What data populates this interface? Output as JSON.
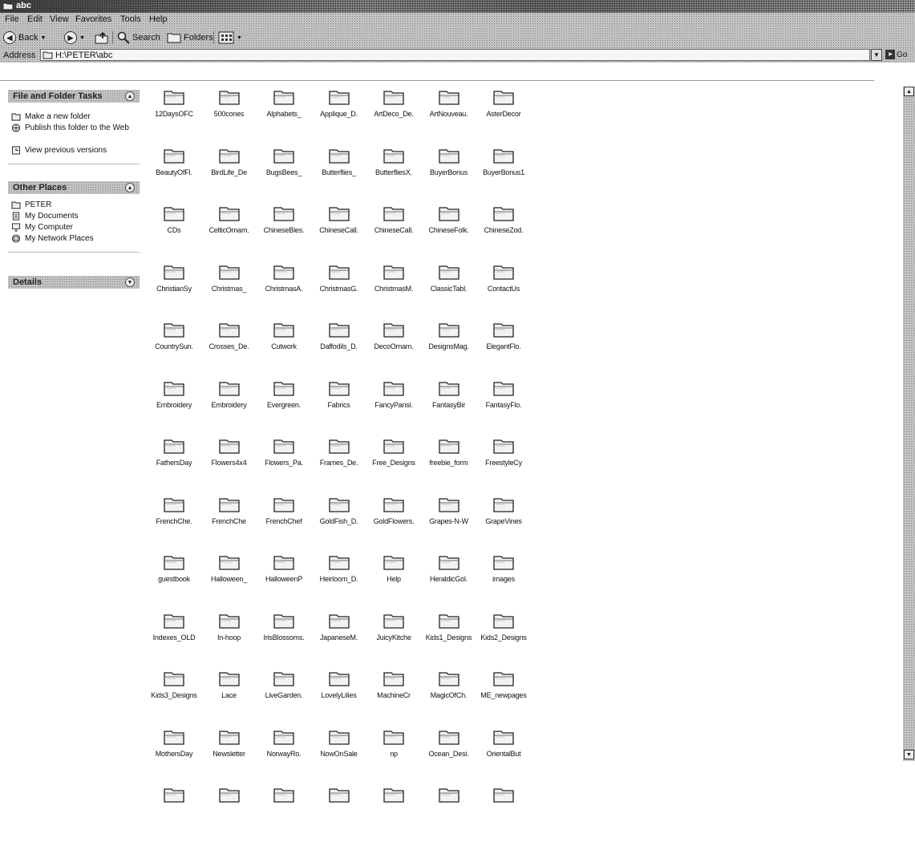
{
  "window": {
    "title": "abc"
  },
  "menu": [
    "File",
    "Edit",
    "View",
    "Favorites",
    "Tools",
    "Help"
  ],
  "toolbar": {
    "back": "Back",
    "search": "Search",
    "folders": "Folders"
  },
  "address": {
    "label": "Address",
    "path": "H:\\PETER\\abc",
    "go": "Go"
  },
  "tasks": {
    "file_folder": {
      "title": "File and Folder Tasks",
      "items": [
        "Make a new folder",
        "Publish this folder to the Web",
        "View previous versions"
      ]
    },
    "other_places": {
      "title": "Other Places",
      "items": [
        "PETER",
        "My Documents",
        "My Computer",
        "My Network Places"
      ]
    },
    "details": {
      "title": "Details"
    }
  },
  "folders": [
    "12DaysOFC",
    "500cones",
    "Alphabets_",
    "Applique_D.",
    "ArtDeco_De.",
    "ArtNouveau.",
    "AsterDecor",
    "BeautyOfFl.",
    "BirdLife_De",
    "BugsBees_",
    "Butterflies_",
    "ButterfliesX.",
    "BuyerBonus",
    "BuyerBonus1",
    "CDs",
    "CelticOrnam.",
    "ChineseBles.",
    "ChineseCall.",
    "ChineseCall.",
    "ChineseFolk.",
    "ChineseZod.",
    "ChristianSy",
    "Christmas_",
    "ChristmasA.",
    "ChristmasG.",
    "ChristmasM.",
    "ClassicTabl.",
    "ContactUs",
    "CountrySun.",
    "Crosses_De.",
    "Cutwork",
    "Daffodils_D.",
    "DecoOrnam.",
    "DesignsMag.",
    "ElegantFlo.",
    "Embroidery",
    "Embroidery",
    "Evergreen.",
    "Fabrics",
    "FancyPansi.",
    "FantasyBir",
    "FantasyFlo.",
    "FathersDay",
    "Flowers4x4",
    "Flowers_Pa.",
    "Frames_De.",
    "Free_Designs",
    "freebie_form",
    "FreestyleCy",
    "FrenchChe.",
    "FrenchChe",
    "FrenchChef",
    "GoldFish_D.",
    "GoldFlowers.",
    "Grapes-N-W",
    "GrapeVines",
    "guestbook",
    "Halloween_",
    "HalloweenP",
    "Heirloom_D.",
    "Help",
    "HeraldicGol.",
    "images",
    "Indexes_OLD",
    "In-hoop",
    "IrisBlossoms.",
    "JapaneseM.",
    "JuicyKitche",
    "Kids1_Designs",
    "Kids2_Designs",
    "Kids3_Designs",
    "Lace",
    "LiveGarden.",
    "LovelyLilies",
    "MachineCr",
    "MagicOfCh.",
    "ME_newpages",
    "MothersDay",
    "Newsletter",
    "NorwayRo.",
    "NowOnSale",
    "np",
    "Ocean_Desi.",
    "OrientalBut",
    "",
    "",
    "",
    "",
    "",
    "",
    ""
  ]
}
